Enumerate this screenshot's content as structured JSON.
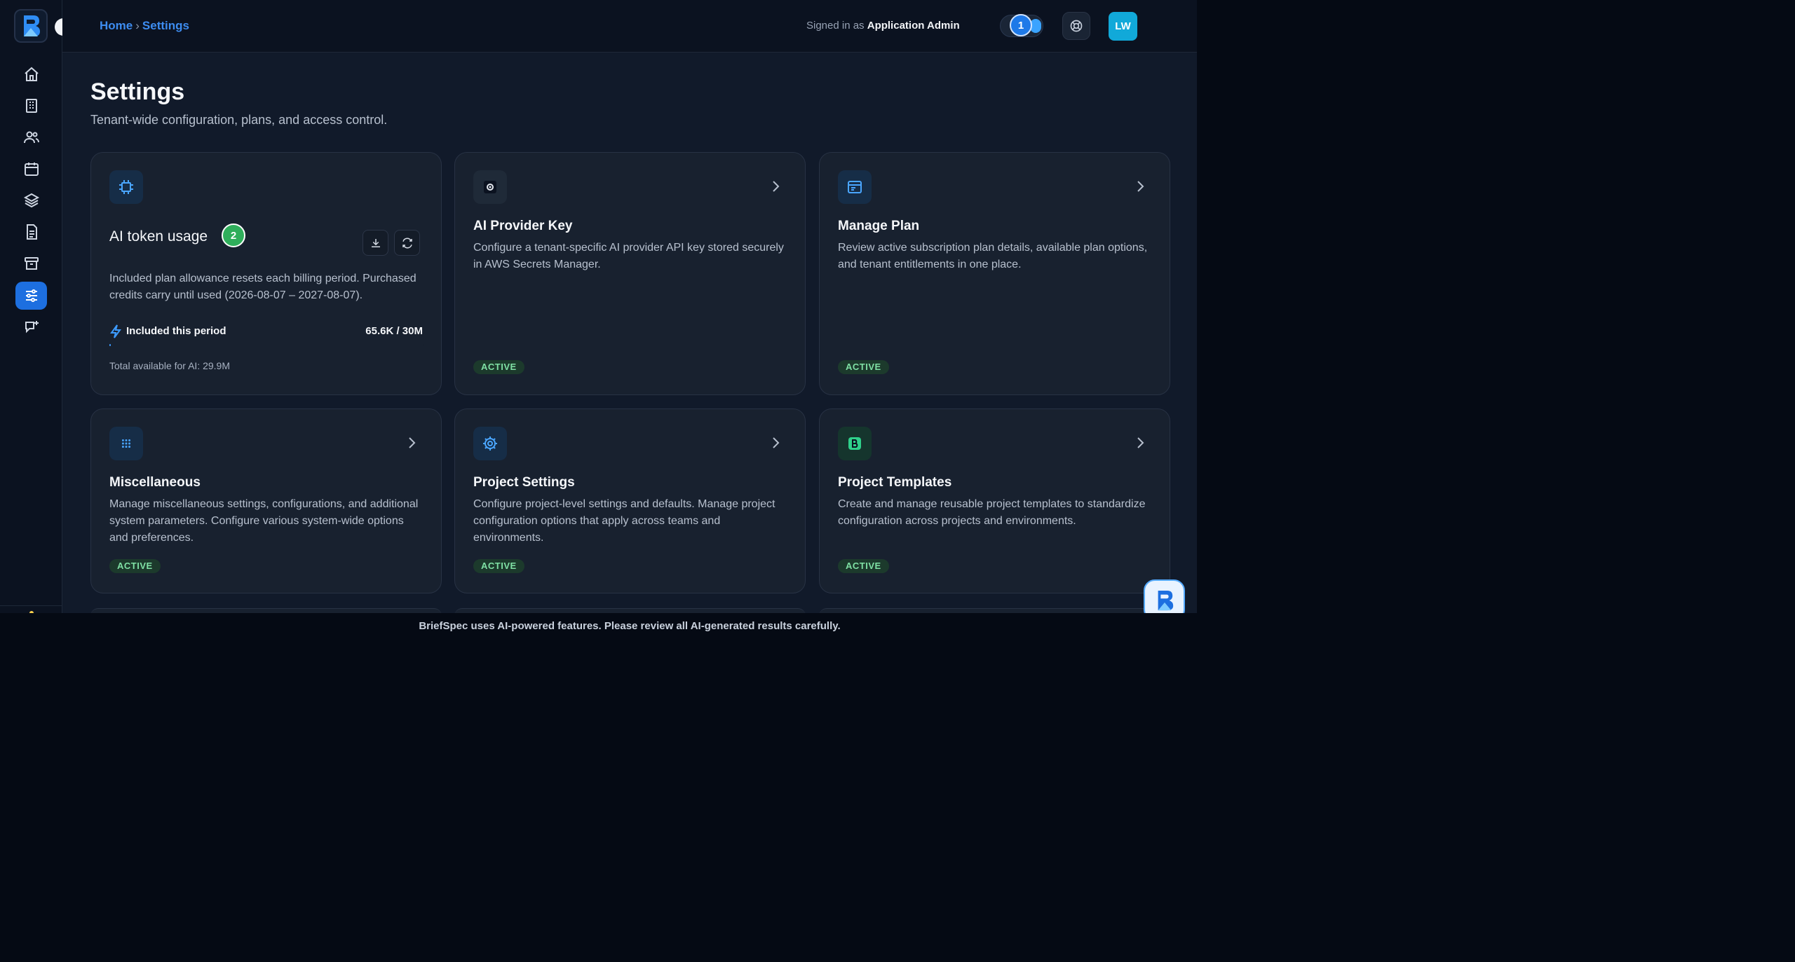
{
  "topbar": {
    "breadcrumb": [
      "Home",
      "Settings"
    ],
    "breadcrumb_separator": "›",
    "signed_in_prefix": "Signed in as",
    "signed_in_user": "Application Admin",
    "toggle_step": "1",
    "avatar_initials": "LW"
  },
  "sidebar": {
    "items": [
      {
        "icon": "home-icon"
      },
      {
        "icon": "building-icon"
      },
      {
        "icon": "users-icon"
      },
      {
        "icon": "calendar-icon"
      },
      {
        "icon": "layers-icon"
      },
      {
        "icon": "document-icon"
      },
      {
        "icon": "archive-icon"
      },
      {
        "icon": "sliders-icon",
        "active": true
      },
      {
        "icon": "chat-plus-icon"
      }
    ]
  },
  "page": {
    "title": "Settings",
    "subtitle": "Tenant-wide configuration, plans, and access control."
  },
  "token_card": {
    "title": "AI token usage",
    "step": "2",
    "description": "Included plan allowance resets each billing period. Purchased credits carry until used (2026-08-07 – 2027-08-07).",
    "included_label": "Included this period",
    "included_value": "65.6K / 30M",
    "used_fraction": 0.0022,
    "total_available": "Total available for AI: 29.9M"
  },
  "cards": [
    {
      "title": "AI Provider Key",
      "description": "Configure a tenant-specific AI provider API key stored securely in AWS Secrets Manager.",
      "status": "ACTIVE",
      "icon": "key-target-icon"
    },
    {
      "title": "Manage Plan",
      "description": "Review active subscription plan details, available plan options, and tenant entitlements in one place.",
      "status": "ACTIVE",
      "icon": "plan-card-icon"
    },
    {
      "title": "Miscellaneous",
      "description": "Manage miscellaneous settings, configurations, and additional system parameters. Configure various system-wide options and preferences.",
      "status": "ACTIVE",
      "icon": "grid-dots-icon"
    },
    {
      "title": "Project Settings",
      "description": "Configure project-level settings and defaults. Manage project configuration options that apply across teams and environments.",
      "status": "ACTIVE",
      "icon": "gear-icon"
    },
    {
      "title": "Project Templates",
      "description": "Create and manage reusable project templates to standardize configuration across projects and environments.",
      "status": "ACTIVE",
      "icon": "template-icon"
    }
  ],
  "footer": {
    "notice": "BriefSpec uses AI-powered features. Please review all AI-generated results carefully."
  },
  "colors": {
    "accent": "#1d6fe0",
    "link": "#3d8cf0",
    "badge_bg": "#1c3a2c",
    "badge_text": "#7fe0a4",
    "step_green": "#2fae5b"
  }
}
